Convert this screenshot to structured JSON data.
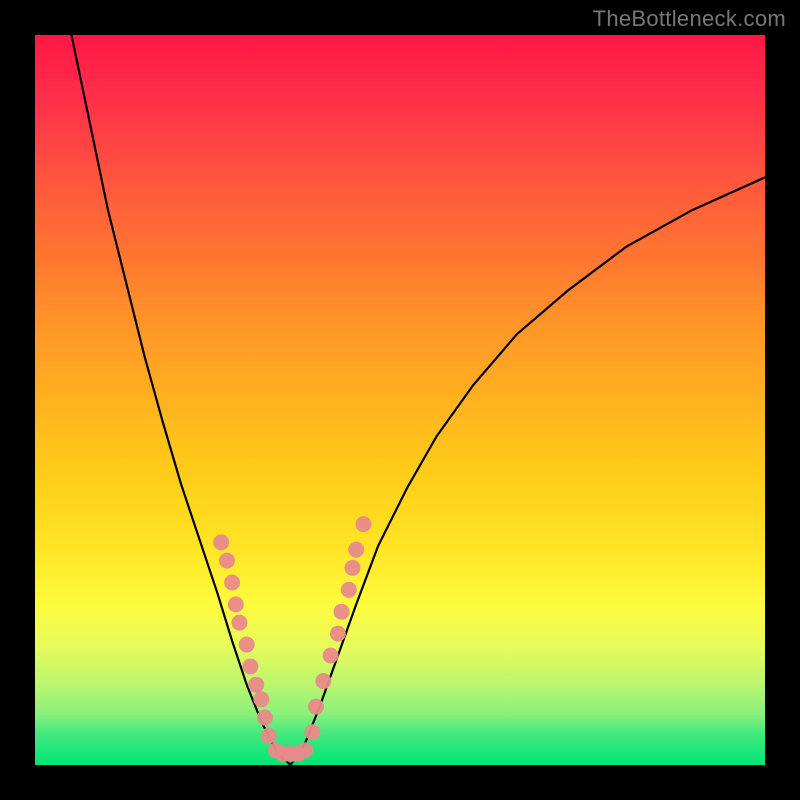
{
  "watermark_text": "TheBottleneck.com",
  "chart_data": {
    "type": "line",
    "title": "",
    "xlabel": "",
    "ylabel": "",
    "xlim": [
      0,
      100
    ],
    "ylim": [
      0,
      100
    ],
    "curves": [
      {
        "name": "left-branch",
        "points": [
          {
            "x": 5.0,
            "y": 100.0
          },
          {
            "x": 7.5,
            "y": 88.0
          },
          {
            "x": 10.0,
            "y": 76.0
          },
          {
            "x": 12.5,
            "y": 66.0
          },
          {
            "x": 15.0,
            "y": 56.0
          },
          {
            "x": 17.5,
            "y": 47.0
          },
          {
            "x": 20.0,
            "y": 38.5
          },
          {
            "x": 22.5,
            "y": 31.0
          },
          {
            "x": 25.0,
            "y": 23.5
          },
          {
            "x": 27.0,
            "y": 17.0
          },
          {
            "x": 29.0,
            "y": 11.0
          },
          {
            "x": 31.0,
            "y": 6.0
          },
          {
            "x": 33.0,
            "y": 2.0
          },
          {
            "x": 35.0,
            "y": 0.0
          }
        ]
      },
      {
        "name": "right-branch",
        "points": [
          {
            "x": 35.0,
            "y": 0.0
          },
          {
            "x": 37.0,
            "y": 3.0
          },
          {
            "x": 39.0,
            "y": 8.0
          },
          {
            "x": 41.5,
            "y": 15.0
          },
          {
            "x": 44.0,
            "y": 22.0
          },
          {
            "x": 47.0,
            "y": 30.0
          },
          {
            "x": 51.0,
            "y": 38.0
          },
          {
            "x": 55.0,
            "y": 45.0
          },
          {
            "x": 60.0,
            "y": 52.0
          },
          {
            "x": 66.0,
            "y": 59.0
          },
          {
            "x": 73.0,
            "y": 65.0
          },
          {
            "x": 81.0,
            "y": 71.0
          },
          {
            "x": 90.0,
            "y": 76.0
          },
          {
            "x": 100.0,
            "y": 80.5
          }
        ]
      }
    ],
    "markers": {
      "name": "data-markers",
      "color": "#e98a8a",
      "radius": 8,
      "points": [
        {
          "x": 25.5,
          "y": 30.5
        },
        {
          "x": 26.3,
          "y": 28.0
        },
        {
          "x": 27.0,
          "y": 25.0
        },
        {
          "x": 27.5,
          "y": 22.0
        },
        {
          "x": 28.0,
          "y": 19.5
        },
        {
          "x": 29.0,
          "y": 16.5
        },
        {
          "x": 29.5,
          "y": 13.5
        },
        {
          "x": 30.3,
          "y": 11.0
        },
        {
          "x": 31.0,
          "y": 9.0
        },
        {
          "x": 31.5,
          "y": 6.5
        },
        {
          "x": 32.0,
          "y": 4.0
        },
        {
          "x": 33.0,
          "y": 2.0
        },
        {
          "x": 34.0,
          "y": 1.5
        },
        {
          "x": 35.0,
          "y": 1.5
        },
        {
          "x": 36.0,
          "y": 1.5
        },
        {
          "x": 37.0,
          "y": 2.0
        },
        {
          "x": 38.0,
          "y": 4.5
        },
        {
          "x": 38.5,
          "y": 8.0
        },
        {
          "x": 39.5,
          "y": 11.5
        },
        {
          "x": 40.5,
          "y": 15.0
        },
        {
          "x": 41.5,
          "y": 18.0
        },
        {
          "x": 42.0,
          "y": 21.0
        },
        {
          "x": 43.0,
          "y": 24.0
        },
        {
          "x": 43.5,
          "y": 27.0
        },
        {
          "x": 44.0,
          "y": 29.5
        },
        {
          "x": 45.0,
          "y": 33.0
        }
      ]
    }
  }
}
